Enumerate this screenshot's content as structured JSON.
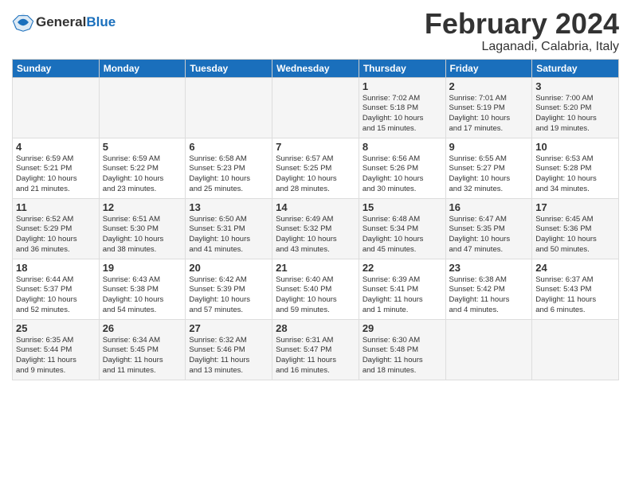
{
  "logo": {
    "line1": "General",
    "line2": "Blue"
  },
  "title": "February 2024",
  "subtitle": "Laganadi, Calabria, Italy",
  "days_of_week": [
    "Sunday",
    "Monday",
    "Tuesday",
    "Wednesday",
    "Thursday",
    "Friday",
    "Saturday"
  ],
  "weeks": [
    [
      {
        "day": "",
        "info": ""
      },
      {
        "day": "",
        "info": ""
      },
      {
        "day": "",
        "info": ""
      },
      {
        "day": "",
        "info": ""
      },
      {
        "day": "1",
        "info": "Sunrise: 7:02 AM\nSunset: 5:18 PM\nDaylight: 10 hours\nand 15 minutes."
      },
      {
        "day": "2",
        "info": "Sunrise: 7:01 AM\nSunset: 5:19 PM\nDaylight: 10 hours\nand 17 minutes."
      },
      {
        "day": "3",
        "info": "Sunrise: 7:00 AM\nSunset: 5:20 PM\nDaylight: 10 hours\nand 19 minutes."
      }
    ],
    [
      {
        "day": "4",
        "info": "Sunrise: 6:59 AM\nSunset: 5:21 PM\nDaylight: 10 hours\nand 21 minutes."
      },
      {
        "day": "5",
        "info": "Sunrise: 6:59 AM\nSunset: 5:22 PM\nDaylight: 10 hours\nand 23 minutes."
      },
      {
        "day": "6",
        "info": "Sunrise: 6:58 AM\nSunset: 5:23 PM\nDaylight: 10 hours\nand 25 minutes."
      },
      {
        "day": "7",
        "info": "Sunrise: 6:57 AM\nSunset: 5:25 PM\nDaylight: 10 hours\nand 28 minutes."
      },
      {
        "day": "8",
        "info": "Sunrise: 6:56 AM\nSunset: 5:26 PM\nDaylight: 10 hours\nand 30 minutes."
      },
      {
        "day": "9",
        "info": "Sunrise: 6:55 AM\nSunset: 5:27 PM\nDaylight: 10 hours\nand 32 minutes."
      },
      {
        "day": "10",
        "info": "Sunrise: 6:53 AM\nSunset: 5:28 PM\nDaylight: 10 hours\nand 34 minutes."
      }
    ],
    [
      {
        "day": "11",
        "info": "Sunrise: 6:52 AM\nSunset: 5:29 PM\nDaylight: 10 hours\nand 36 minutes."
      },
      {
        "day": "12",
        "info": "Sunrise: 6:51 AM\nSunset: 5:30 PM\nDaylight: 10 hours\nand 38 minutes."
      },
      {
        "day": "13",
        "info": "Sunrise: 6:50 AM\nSunset: 5:31 PM\nDaylight: 10 hours\nand 41 minutes."
      },
      {
        "day": "14",
        "info": "Sunrise: 6:49 AM\nSunset: 5:32 PM\nDaylight: 10 hours\nand 43 minutes."
      },
      {
        "day": "15",
        "info": "Sunrise: 6:48 AM\nSunset: 5:34 PM\nDaylight: 10 hours\nand 45 minutes."
      },
      {
        "day": "16",
        "info": "Sunrise: 6:47 AM\nSunset: 5:35 PM\nDaylight: 10 hours\nand 47 minutes."
      },
      {
        "day": "17",
        "info": "Sunrise: 6:45 AM\nSunset: 5:36 PM\nDaylight: 10 hours\nand 50 minutes."
      }
    ],
    [
      {
        "day": "18",
        "info": "Sunrise: 6:44 AM\nSunset: 5:37 PM\nDaylight: 10 hours\nand 52 minutes."
      },
      {
        "day": "19",
        "info": "Sunrise: 6:43 AM\nSunset: 5:38 PM\nDaylight: 10 hours\nand 54 minutes."
      },
      {
        "day": "20",
        "info": "Sunrise: 6:42 AM\nSunset: 5:39 PM\nDaylight: 10 hours\nand 57 minutes."
      },
      {
        "day": "21",
        "info": "Sunrise: 6:40 AM\nSunset: 5:40 PM\nDaylight: 10 hours\nand 59 minutes."
      },
      {
        "day": "22",
        "info": "Sunrise: 6:39 AM\nSunset: 5:41 PM\nDaylight: 11 hours\nand 1 minute."
      },
      {
        "day": "23",
        "info": "Sunrise: 6:38 AM\nSunset: 5:42 PM\nDaylight: 11 hours\nand 4 minutes."
      },
      {
        "day": "24",
        "info": "Sunrise: 6:37 AM\nSunset: 5:43 PM\nDaylight: 11 hours\nand 6 minutes."
      }
    ],
    [
      {
        "day": "25",
        "info": "Sunrise: 6:35 AM\nSunset: 5:44 PM\nDaylight: 11 hours\nand 9 minutes."
      },
      {
        "day": "26",
        "info": "Sunrise: 6:34 AM\nSunset: 5:45 PM\nDaylight: 11 hours\nand 11 minutes."
      },
      {
        "day": "27",
        "info": "Sunrise: 6:32 AM\nSunset: 5:46 PM\nDaylight: 11 hours\nand 13 minutes."
      },
      {
        "day": "28",
        "info": "Sunrise: 6:31 AM\nSunset: 5:47 PM\nDaylight: 11 hours\nand 16 minutes."
      },
      {
        "day": "29",
        "info": "Sunrise: 6:30 AM\nSunset: 5:48 PM\nDaylight: 11 hours\nand 18 minutes."
      },
      {
        "day": "",
        "info": ""
      },
      {
        "day": "",
        "info": ""
      }
    ]
  ]
}
